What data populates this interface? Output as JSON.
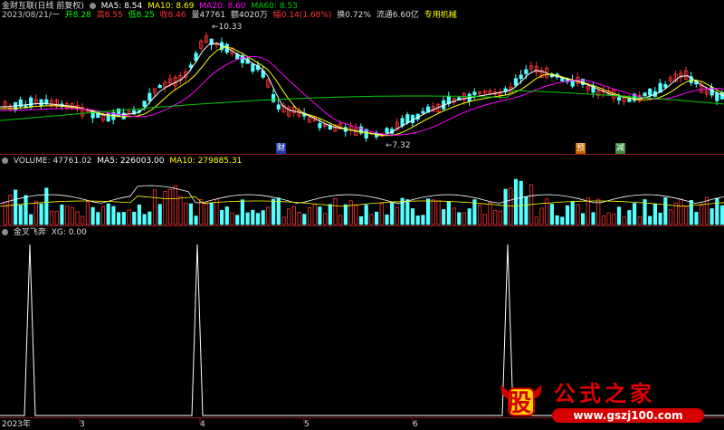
{
  "header": {
    "name": "金财互联(日线 前复权)",
    "ma5": "MA5: 8.54",
    "ma10": "MA10: 8.69",
    "ma20": "MA20: 8.60",
    "ma60": "MA60: 8.53",
    "info_date": "2023/08/21/一",
    "open": "开8.28",
    "high": "高8.55",
    "low": "低8.25",
    "close": "收8.46",
    "vol": "量47761",
    "amt": "额4020万",
    "chg": "幅0.14(1.68%)",
    "turnover": "换0.72%",
    "float": "流通6.60亿",
    "sector": "专用机械"
  },
  "price_labels": {
    "hi": "10.33",
    "lo": "7.32",
    "mark1": "财",
    "mark2": "预",
    "mark3": "减"
  },
  "volume_header": {
    "vol": "VOLUME: 47761.02",
    "ma5": "MA5: 226003.00",
    "ma10": "MA10: 279885.31"
  },
  "indicator_header": {
    "name": "金叉飞奔",
    "xg": "XG: 0.00"
  },
  "xaxis": {
    "y2023": "2023年",
    "m3": "3",
    "m4": "4",
    "m5": "5",
    "m6": "6"
  },
  "watermark": {
    "glyph": "股",
    "title": "公式之家",
    "url": "www.gszj100.com"
  },
  "colors": {
    "up": "#ff3232",
    "down": "#54ffff",
    "ma5": "#ffffff",
    "ma10": "#ffff00",
    "ma20": "#ff00ff",
    "ma60": "#00cc00",
    "bg": "#000000"
  }
}
